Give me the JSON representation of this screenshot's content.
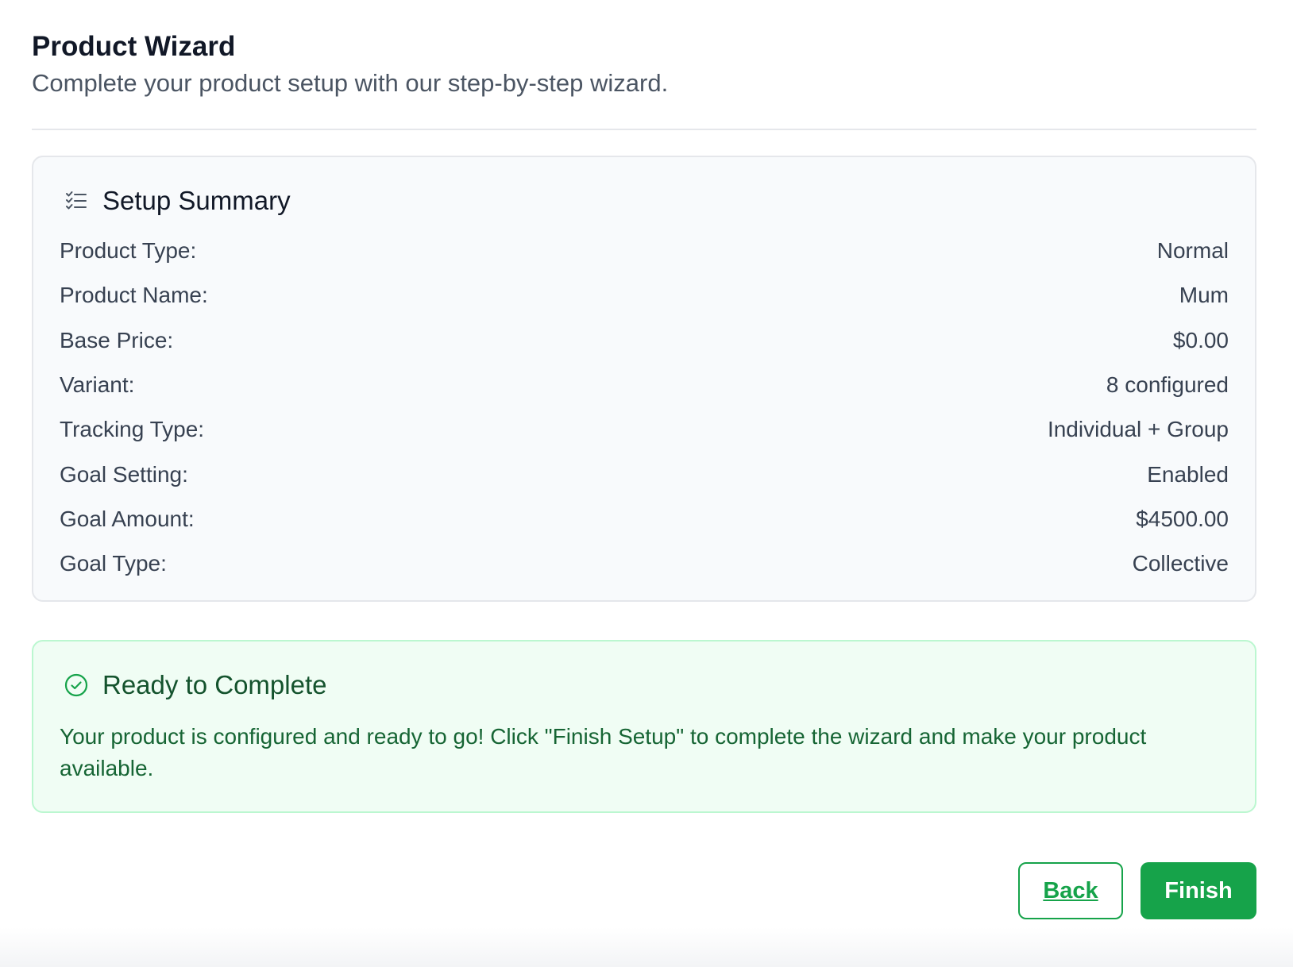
{
  "header": {
    "title": "Product Wizard",
    "subtitle": "Complete your product setup with our step-by-step wizard."
  },
  "summary": {
    "icon": "checklist-icon",
    "title": "Setup Summary",
    "rows": [
      {
        "label": "Product Type:",
        "value": "Normal"
      },
      {
        "label": "Product Name:",
        "value": "Mum"
      },
      {
        "label": "Base Price:",
        "value": "$0.00"
      },
      {
        "label": "Variant:",
        "value": "8 configured"
      },
      {
        "label": "Tracking Type:",
        "value": "Individual + Group"
      },
      {
        "label": "Goal Setting:",
        "value": "Enabled"
      },
      {
        "label": "Goal Amount:",
        "value": "$4500.00"
      },
      {
        "label": "Goal Type:",
        "value": "Collective"
      }
    ]
  },
  "ready": {
    "icon": "check-circle-icon",
    "title": "Ready to Complete",
    "message": "Your product is configured and ready to go! Click \"Finish Setup\" to complete the wizard and make your product available."
  },
  "actions": {
    "back_label": "Back",
    "finish_label": "Finish"
  },
  "colors": {
    "accent": "#16a34a",
    "success_bg": "#f0fdf4",
    "success_border": "#bbf7d0",
    "summary_bg": "#f8fafc"
  }
}
